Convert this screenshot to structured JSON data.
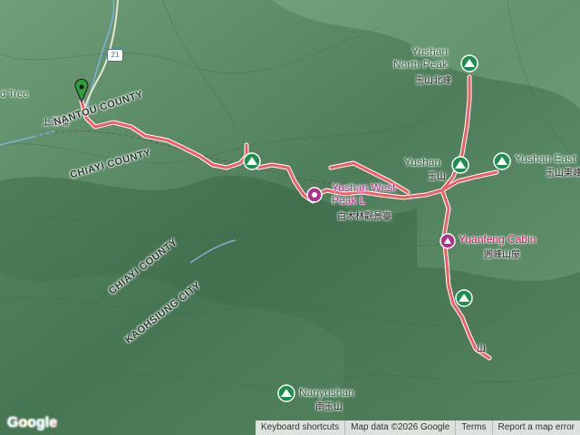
{
  "map": {
    "road_number": "21",
    "labels": {
      "tree_partial": "d Tree",
      "shangdongpu": "上東埔",
      "nantou": "NANTOU COUNTY",
      "chiayi_upper": "CHIAYI COUNTY",
      "chiayi_lower": "CHIAYI COUNTY",
      "kaohsiung": "KAOHSIUNG CITY"
    },
    "peaks": [
      {
        "en_line1": "Yushan",
        "en_line2": "North Peak",
        "zh": "玉山北峰"
      },
      {
        "en_line1": "Yushan",
        "en_line2": "",
        "zh": "玉山"
      },
      {
        "en_line1": "Yushan East",
        "en_line2": "",
        "zh": "玉山東峰"
      },
      {
        "en_line1": "Nanyushan",
        "en_line2": "",
        "zh": "南玉山"
      },
      {
        "en_line1": "",
        "en_line2": "",
        "zh": "山"
      }
    ],
    "viewpoint": {
      "en_line1": "Yushan West",
      "en_line2": "Peak L",
      "zh": "白木林觀景臺"
    },
    "cabin": {
      "en": "Yuanfeng Cabin",
      "zh": "圓峰山屋"
    },
    "colors": {
      "route": "#f25c66",
      "route_outline": "#ffffff",
      "terrain": "#5f8f6b",
      "peak_marker": "#1e8e4e",
      "viewpoint_marker": "#b0318a",
      "start_pin": "#2e9e3e",
      "river": "#7fb0d6"
    }
  },
  "footer": {
    "google_logo": "Google",
    "keyboard_shortcuts": "Keyboard shortcuts",
    "map_data": "Map data ©2026 Google",
    "terms": "Terms",
    "report": "Report a map error"
  }
}
